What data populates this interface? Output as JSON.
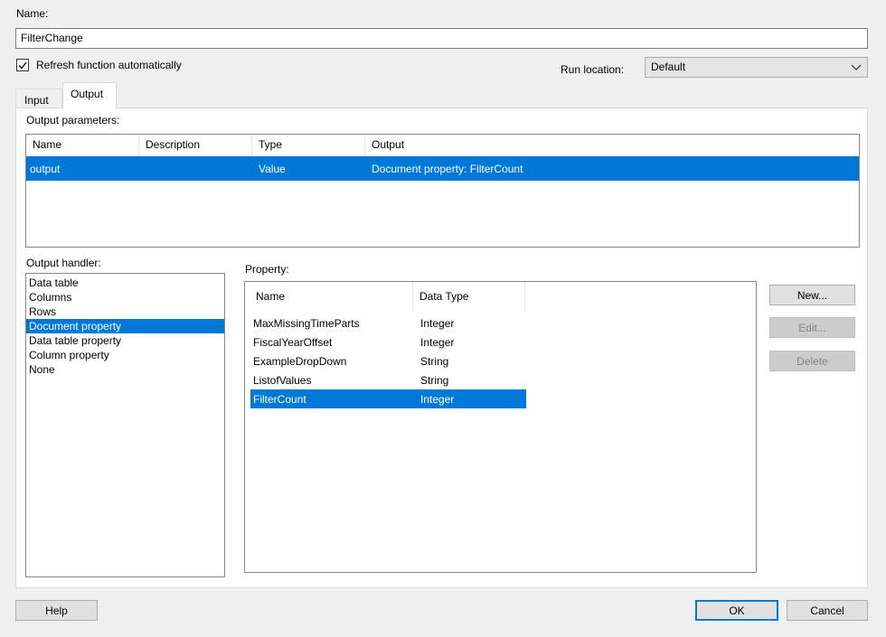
{
  "name_field": {
    "label": "Name:",
    "value": "FilterChange"
  },
  "refresh": {
    "label": "Refresh function automatically",
    "checked": true
  },
  "run_location": {
    "label": "Run location:",
    "selected": "Default"
  },
  "tabs": [
    {
      "label": "Input"
    },
    {
      "label": "Output"
    }
  ],
  "output_parameters": {
    "label": "Output parameters:",
    "columns": [
      "Name",
      "Description",
      "Type",
      "Output"
    ],
    "rows": [
      {
        "name": "output",
        "description": "",
        "type": "Value",
        "output": "Document property: FilterCount",
        "selected": true
      }
    ]
  },
  "output_handler": {
    "label": "Output handler:",
    "items": [
      "Data table",
      "Columns",
      "Rows",
      "Document property",
      "Data table property",
      "Column property",
      "None"
    ],
    "selected_index": 3
  },
  "property": {
    "label": "Property:",
    "columns": [
      "Name",
      "Data Type"
    ],
    "rows": [
      {
        "name": "MaxMissingTimeParts",
        "type": "Integer"
      },
      {
        "name": "FiscalYearOffset",
        "type": "Integer"
      },
      {
        "name": "ExampleDropDown",
        "type": "String"
      },
      {
        "name": "ListofValues",
        "type": "String"
      },
      {
        "name": "FilterCount",
        "type": "Integer"
      }
    ],
    "selected_index": 4
  },
  "side_buttons": {
    "new": "New...",
    "edit": "Edit...",
    "delete": "Delete"
  },
  "footer": {
    "help": "Help",
    "ok": "OK",
    "cancel": "Cancel"
  },
  "colors": {
    "selection": "#0078d7",
    "window_bg": "#f0f0f0"
  },
  "icons": {
    "checkbox": "check-icon",
    "dropdown": "chevron-down-icon"
  }
}
